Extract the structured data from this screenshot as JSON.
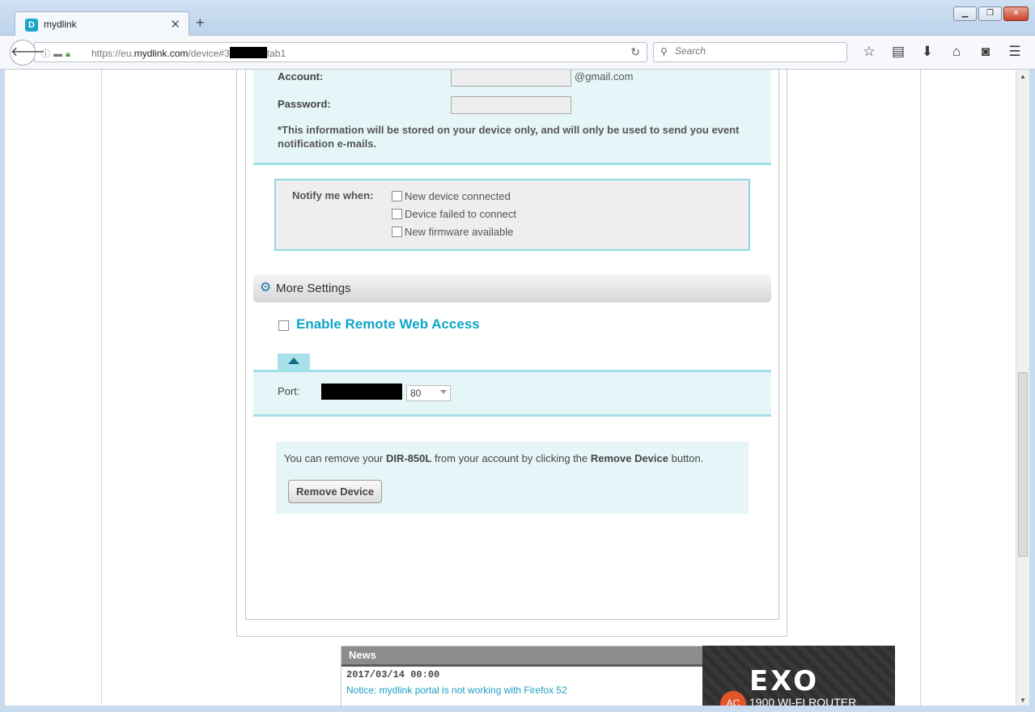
{
  "browser": {
    "tab_title": "mydlink",
    "tab_favicon": "D",
    "url_prefix": "https://eu.",
    "url_host": "mydlink.com",
    "url_path_before": "/device#3",
    "url_path_after": "tab1",
    "search_placeholder": "Search"
  },
  "email": {
    "account_label": "Account:",
    "domain_suffix": "@gmail.com",
    "password_label": "Password:",
    "note": "*This information will be stored on your device only, and will only be used to send you event notification e-mails."
  },
  "notify": {
    "label": "Notify me when:",
    "options": [
      "New device connected",
      "Device failed to connect",
      "New firmware available"
    ]
  },
  "more_settings": {
    "label": "More Settings"
  },
  "remote": {
    "title": "Enable Remote Web Access"
  },
  "port": {
    "label": "Port:",
    "value": "80"
  },
  "remove": {
    "text_prefix": "You can remove your ",
    "device_model": "DIR-850L",
    "text_middle": " from your account by clicking the ",
    "button_ref": "Remove Device",
    "text_suffix": " button.",
    "button_label": "Remove Device"
  },
  "news": {
    "title": "News",
    "date": "2017/03/14 00:00",
    "headline": "Notice: mydlink portal is not working with Firefox 52"
  },
  "ad": {
    "logo": "EXO",
    "badge": "AC",
    "subtitle": "1900 WI-FI ROUTER"
  }
}
